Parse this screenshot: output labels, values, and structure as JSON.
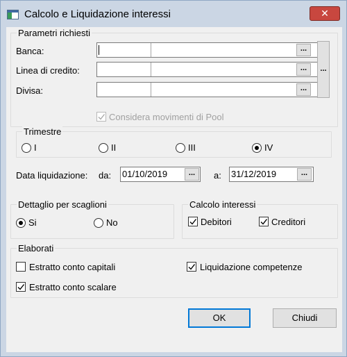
{
  "window": {
    "title": "Calcolo e Liquidazione interessi",
    "close_icon": "close-icon"
  },
  "params": {
    "legend": "Parametri richiesti",
    "banca_label": "Banca:",
    "linea_label": "Linea di credito:",
    "divisa_label": "Divisa:",
    "banca_value": "",
    "linea_value": "",
    "divisa_value": "",
    "ellipsis": "...",
    "pool_label": "Considera movimenti di Pool",
    "pool_checked": true,
    "pool_enabled": false
  },
  "trimestre": {
    "legend": "Trimestre",
    "options": [
      "I",
      "II",
      "III",
      "IV"
    ],
    "selected": "IV"
  },
  "data_liq": {
    "label": "Data liquidazione:",
    "da_label": "da:",
    "da_value": "01/10/2019",
    "a_label": "a:",
    "a_value": "31/12/2019"
  },
  "dettaglio": {
    "legend": "Dettaglio per scaglioni",
    "options": [
      "Si",
      "No"
    ],
    "selected": "Si"
  },
  "calcolo": {
    "legend": "Calcolo interessi",
    "debitori_label": "Debitori",
    "creditori_label": "Creditori",
    "debitori_checked": true,
    "creditori_checked": true
  },
  "elaborati": {
    "legend": "Elaborati",
    "capitali_label": "Estratto conto capitali",
    "capitali_checked": false,
    "scalare_label": "Estratto conto scalare",
    "scalare_checked": true,
    "competenze_label": "Liquidazione competenze",
    "competenze_checked": true
  },
  "buttons": {
    "ok_label": "OK",
    "cancel_label": "Chiudi"
  },
  "colors": {
    "title_bg": "#cbd6e4",
    "close_red": "#c8473f",
    "face": "#f0f0f0",
    "focus_blue": "#0078d7"
  }
}
